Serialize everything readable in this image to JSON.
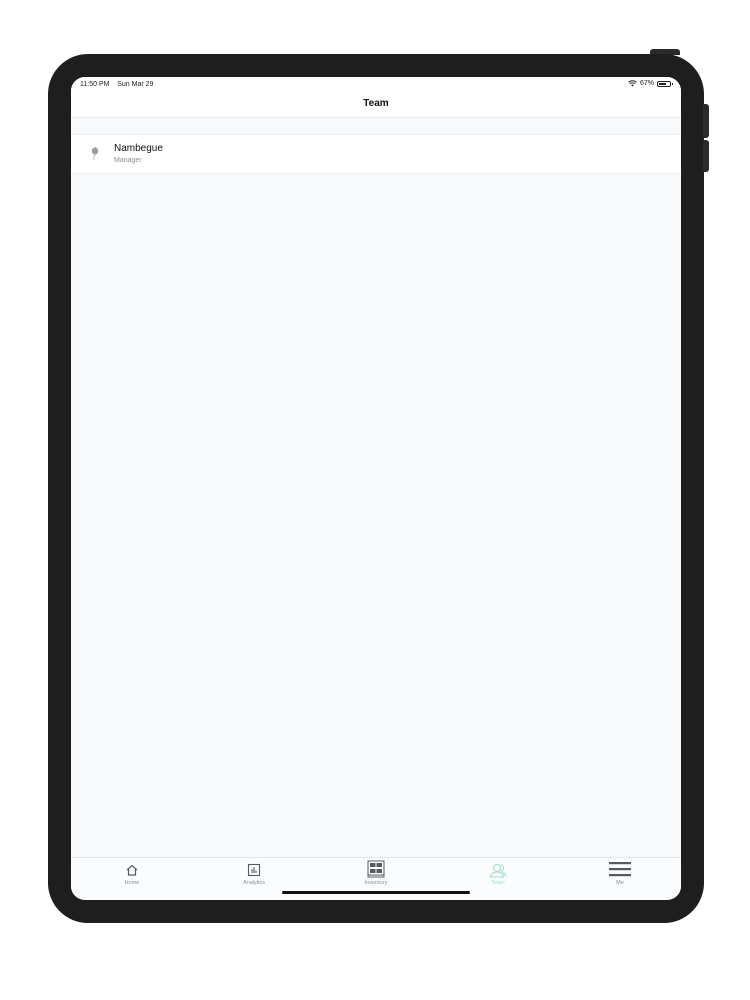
{
  "status_bar": {
    "time": "11:50 PM",
    "date": "Sun Mar 29",
    "battery": "67%",
    "battery_level": 0.67
  },
  "nav": {
    "title": "Team"
  },
  "team": {
    "members": [
      {
        "name": "Nambegue",
        "role": "Manager"
      }
    ]
  },
  "tabs": [
    {
      "label": "Home",
      "icon": "home-icon"
    },
    {
      "label": "Analytics",
      "icon": "analytics-icon"
    },
    {
      "label": "Inventory",
      "icon": "inventory-icon"
    },
    {
      "label": "Team",
      "icon": "team-icon",
      "active": true
    },
    {
      "label": "Me",
      "icon": "menu-icon"
    }
  ],
  "colors": {
    "active_tab": "#9fdcc9",
    "inactive_tab": "#8a8f96",
    "background": "#f8f9fb"
  }
}
